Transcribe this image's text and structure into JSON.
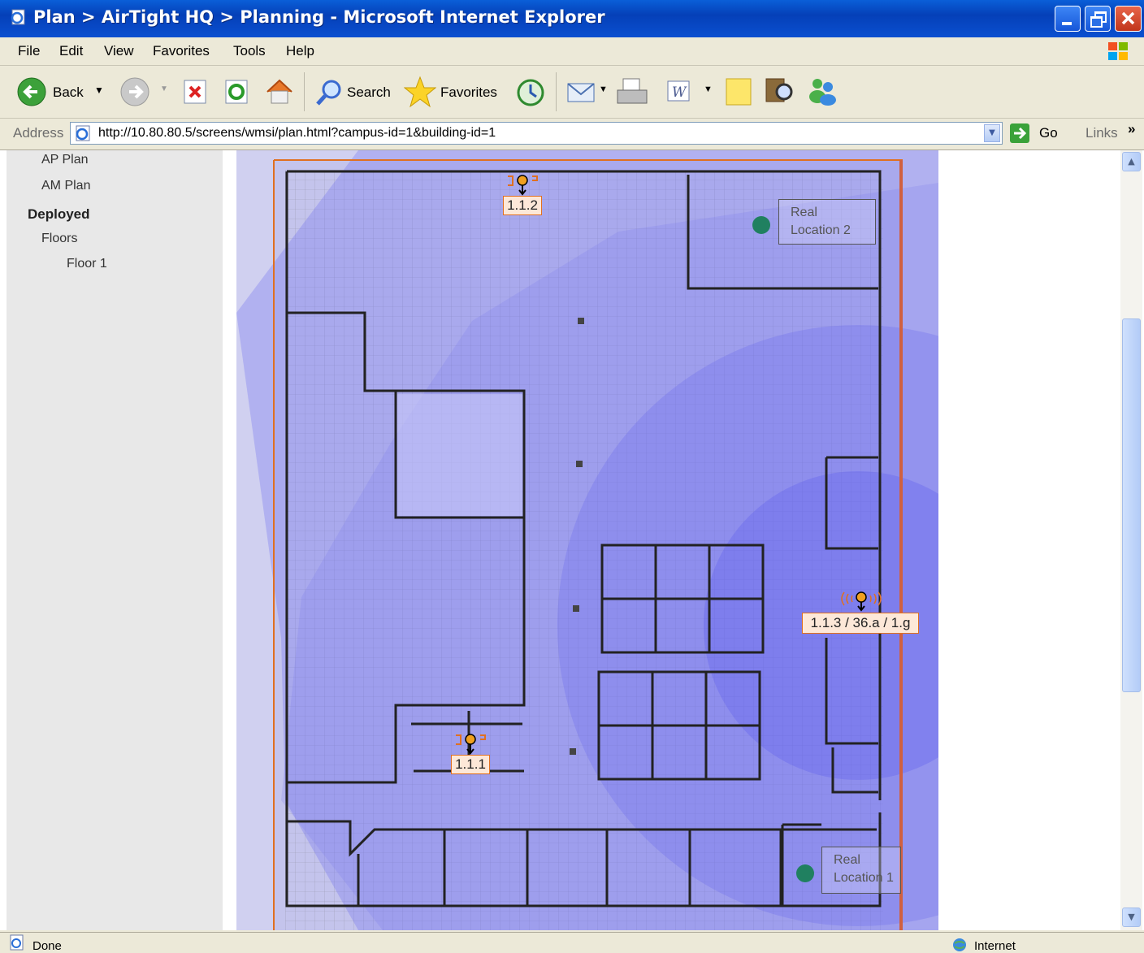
{
  "window": {
    "title": "Plan > AirTight HQ > Planning - Microsoft Internet Explorer"
  },
  "menu": [
    "File",
    "Edit",
    "View",
    "Favorites",
    "Tools",
    "Help"
  ],
  "toolbar": {
    "back": "Back",
    "search": "Search",
    "favorites": "Favorites"
  },
  "address": {
    "label": "Address",
    "url": "http://10.80.80.5/screens/wmsi/plan.html?campus-id=1&building-id=1",
    "go": "Go",
    "links": "Links"
  },
  "sidebar": {
    "items": [
      {
        "label": "AP Plan",
        "bold": false
      },
      {
        "label": "AM Plan",
        "bold": false
      },
      {
        "label": "Deployed",
        "bold": true
      },
      {
        "label": "Floors",
        "bold": false
      },
      {
        "label": "Floor 1",
        "bold": false
      }
    ]
  },
  "plan": {
    "devices": [
      {
        "label": "1.1.2"
      },
      {
        "label": "1.1.1"
      },
      {
        "label": "1.1.3 / 36.a / 1.g"
      }
    ],
    "locations": [
      {
        "line1": "Real",
        "line2": "Location 2"
      },
      {
        "line1": "Real",
        "line2": "Location 1"
      }
    ]
  },
  "status": {
    "left": "Done",
    "zone": "Internet"
  },
  "colors": {
    "titlebar": "#0a4fd0",
    "chrome": "#ece9d8",
    "coverage": "#7070f0",
    "accent": "#e07020"
  }
}
